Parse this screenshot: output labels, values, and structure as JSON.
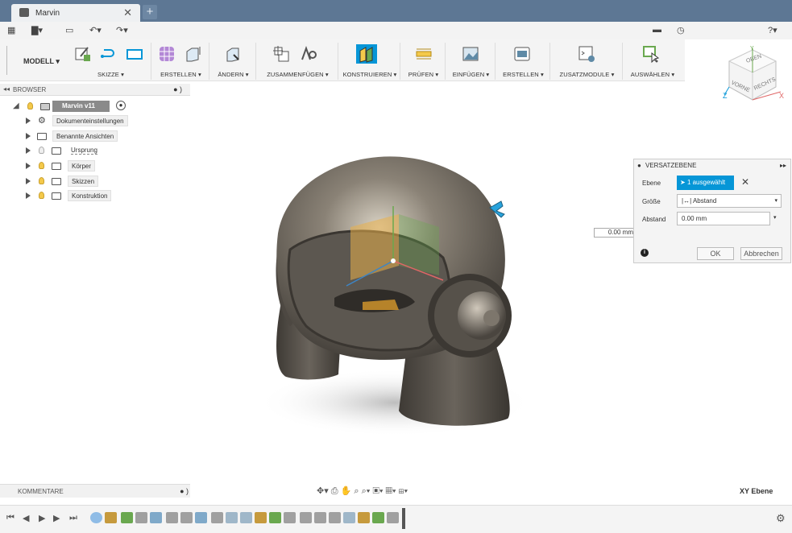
{
  "window": {
    "tab_title": "Marvin",
    "tab_close": "✕",
    "new_tab": "+"
  },
  "quick_access": {
    "grid": "▦",
    "file": "▇▾",
    "save": "▭",
    "undo": "↶▾",
    "redo": "↷▾",
    "chat": "▬",
    "clock": "◷",
    "help": "?▾"
  },
  "ribbon": {
    "mode": "MODELL ▾",
    "groups": [
      {
        "label": "SKIZZE ▾"
      },
      {
        "label": "ERSTELLEN ▾"
      },
      {
        "label": "ÄNDERN ▾"
      },
      {
        "label": "ZUSAMMENFÜGEN ▾"
      },
      {
        "label": "KONSTRUIEREN ▾"
      },
      {
        "label": "PRÜFEN ▾"
      },
      {
        "label": "EINFÜGEN ▾"
      },
      {
        "label": "ERSTELLEN ▾"
      },
      {
        "label": "ZUSATZMODULE ▾"
      },
      {
        "label": "AUSWÄHLEN ▾"
      }
    ]
  },
  "browser": {
    "title": "BROWSER",
    "root": "Marvin v11",
    "items": [
      {
        "label": "Dokumenteinstellungen"
      },
      {
        "label": "Benannte Ansichten"
      },
      {
        "label": "Ursprung"
      },
      {
        "label": "Körper"
      },
      {
        "label": "Skizzen"
      },
      {
        "label": "Konstruktion"
      }
    ]
  },
  "viewcube": {
    "top": "OBEN",
    "front": "VORNE",
    "right": "RECHTS",
    "axis_x": "X",
    "axis_y": "Y",
    "axis_z": "Z"
  },
  "dialog": {
    "title": "VERSATZEBENE",
    "rows": {
      "ebene_label": "Ebene",
      "ebene_value": "1 ausgewählt",
      "groesse_label": "Größe",
      "groesse_value": "Abstand",
      "abstand_label": "Abstand",
      "abstand_value": "0.00 mm"
    },
    "ok": "OK",
    "cancel": "Abbrechen"
  },
  "viewport_input": "0.00 mm",
  "comments": {
    "title": "KOMMENTARE"
  },
  "nav_tools": "✥▾ ⎙ ✋ ⌕ ⌕▾ ▣▾ ▦▾ ⊞▾",
  "active_plane": "XY Ebene",
  "colors": {
    "titlebar": "#5d7794",
    "accent": "#0696d7",
    "body_dark": "#5a554e"
  }
}
